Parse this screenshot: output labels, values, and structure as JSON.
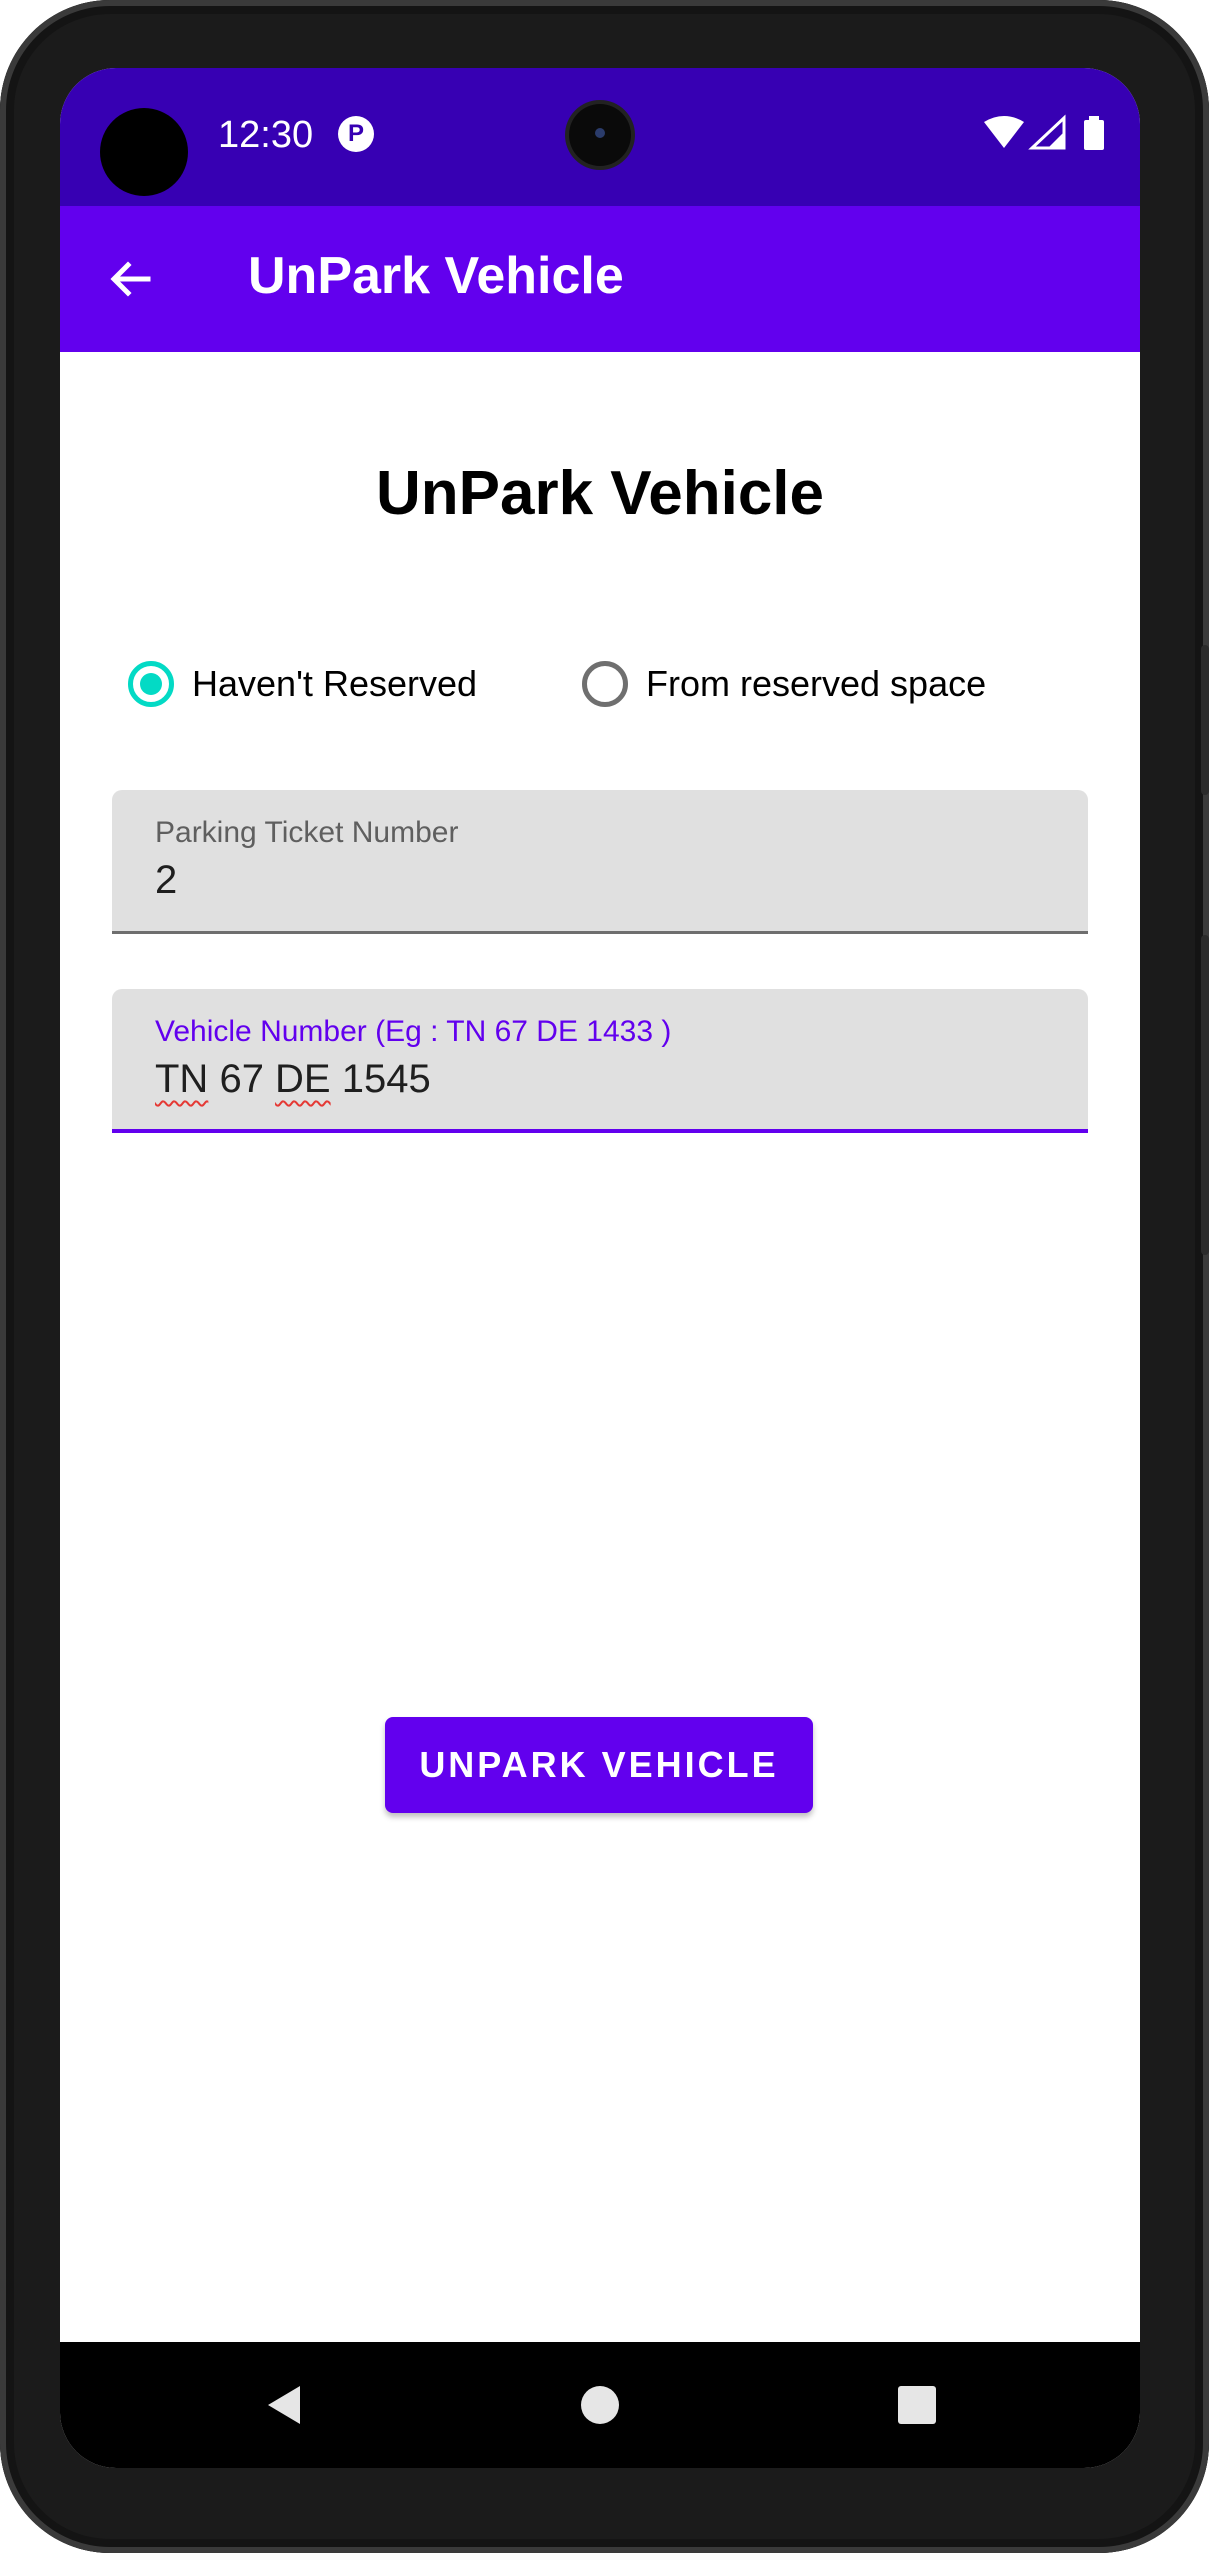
{
  "status_bar": {
    "time": "12:30",
    "notification_icon": "app-notification-icon",
    "icons": [
      "wifi-icon",
      "signal-icon",
      "battery-icon"
    ]
  },
  "app_bar": {
    "title": "UnPark Vehicle",
    "back_icon": "arrow-back-icon"
  },
  "main": {
    "heading": "UnPark Vehicle",
    "radio_options": [
      {
        "label": "Haven't Reserved",
        "selected": true
      },
      {
        "label": "From reserved space",
        "selected": false
      }
    ],
    "ticket_field": {
      "label": "Parking Ticket Number",
      "value": "2"
    },
    "vehicle_field": {
      "label": "Vehicle Number (Eg : TN 67 DE 1433 )",
      "value_parts": [
        "TN",
        " 67 ",
        "DE",
        " 1545"
      ],
      "value": "TN 67 DE 1545"
    },
    "submit_button": "UNPARK VEHICLE"
  },
  "nav_bar": {
    "buttons": [
      "nav-back-icon",
      "nav-home-icon",
      "nav-recents-icon"
    ]
  },
  "colors": {
    "status_bar": "#3700b3",
    "app_bar": "#6200ee",
    "accent": "#03dac5",
    "field_bg": "#e0e0e0",
    "button": "#6200ee"
  }
}
